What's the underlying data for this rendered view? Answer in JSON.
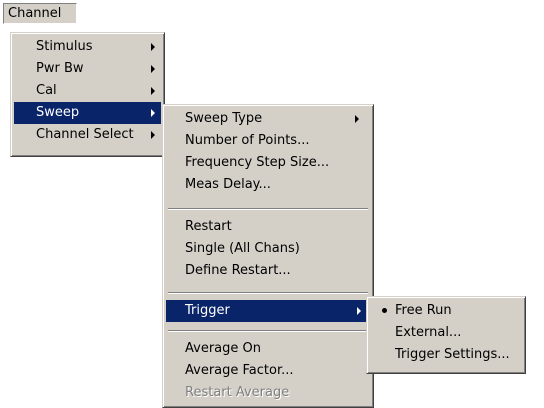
{
  "menubar": {
    "channel_label": "Channel"
  },
  "channel_menu": {
    "items": [
      {
        "label": "Stimulus"
      },
      {
        "label": "Pwr Bw"
      },
      {
        "label": "Cal"
      },
      {
        "label": "Sweep"
      },
      {
        "label": "Channel Select"
      }
    ]
  },
  "sweep_menu": {
    "items": [
      {
        "label": "Sweep Type"
      },
      {
        "label": "Number of Points..."
      },
      {
        "label": "Frequency Step Size..."
      },
      {
        "label": "Meas Delay..."
      },
      {
        "label": "Restart"
      },
      {
        "label": "Single (All Chans)"
      },
      {
        "label": "Define Restart..."
      },
      {
        "label": "Trigger"
      },
      {
        "label": "Average On"
      },
      {
        "label": "Average Factor..."
      },
      {
        "label": "Restart Average"
      }
    ]
  },
  "trigger_menu": {
    "items": [
      {
        "label": "Free Run"
      },
      {
        "label": "External..."
      },
      {
        "label": "Trigger Settings..."
      }
    ]
  },
  "colors": {
    "menu_bg": "#d4d0c8",
    "highlight": "#0a246a",
    "highlight_text": "#ffffff",
    "disabled_text": "#808080"
  }
}
